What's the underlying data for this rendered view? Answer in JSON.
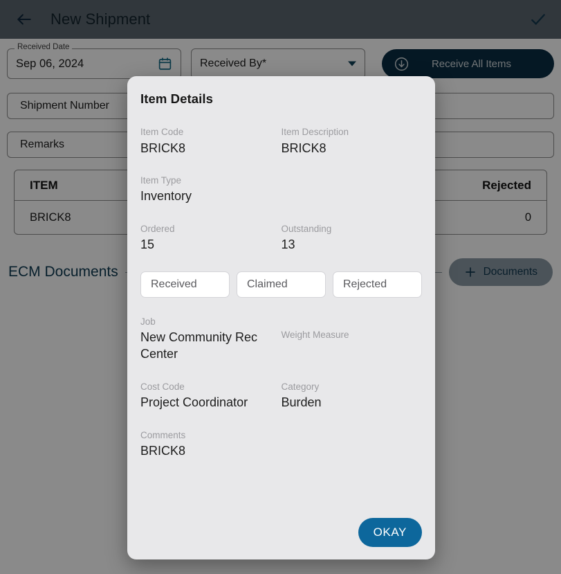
{
  "appbar": {
    "back_icon": "arrow-left-icon",
    "title": "New Shipment",
    "confirm_icon": "check-icon"
  },
  "form": {
    "received_date": {
      "legend": "Received Date",
      "value": "Sep 06, 2024",
      "icon": "calendar-icon"
    },
    "received_by": {
      "value": "Received By*",
      "icon": "chevron-down-icon"
    },
    "receive_all": {
      "label": "Receive All Items",
      "icon": "download-circle-icon"
    },
    "shipment_number": {
      "placeholder": "Shipment Number",
      "value": "Shipment Number"
    },
    "remarks": {
      "placeholder": "Remarks",
      "value": "Remarks"
    }
  },
  "items_table": {
    "columns": [
      "ITEM",
      "Rejected"
    ],
    "rows": [
      {
        "item": "BRICK8",
        "rejected": "0"
      }
    ]
  },
  "ecm": {
    "title": "ECM Documents",
    "documents_button": {
      "label": "Documents",
      "icon": "plus-icon"
    }
  },
  "dialog": {
    "title": "Item Details",
    "fields": {
      "item_code": {
        "label": "Item Code",
        "value": "BRICK8"
      },
      "item_description": {
        "label": "Item Description",
        "value": "BRICK8"
      },
      "item_type": {
        "label": "Item Type",
        "value": "Inventory"
      },
      "blank_after_item_type": {
        "label": "",
        "value": ""
      },
      "ordered": {
        "label": "Ordered",
        "value": "15"
      },
      "outstanding": {
        "label": "Outstanding",
        "value": "13"
      },
      "job": {
        "label": "Job",
        "value": "New Community Rec Center"
      },
      "weight_measure": {
        "label": "Weight Measure",
        "value": ""
      },
      "cost_code": {
        "label": "Cost Code",
        "value": "Project Coordinator"
      },
      "category": {
        "label": "Category",
        "value": "Burden"
      },
      "comments": {
        "label": "Comments",
        "value": "BRICK8"
      }
    },
    "inputs": {
      "received": {
        "placeholder": "Received",
        "value": ""
      },
      "claimed": {
        "placeholder": "Claimed",
        "value": ""
      },
      "rejected": {
        "placeholder": "Rejected",
        "value": ""
      }
    },
    "okay_button": "OKAY"
  },
  "colors": {
    "appbar": "#5b6770",
    "accent_dark": "#0b2e44",
    "accent_blue": "#0d679c",
    "dialog_bg": "#e8e8ea",
    "link_text": "#0d3a52"
  }
}
